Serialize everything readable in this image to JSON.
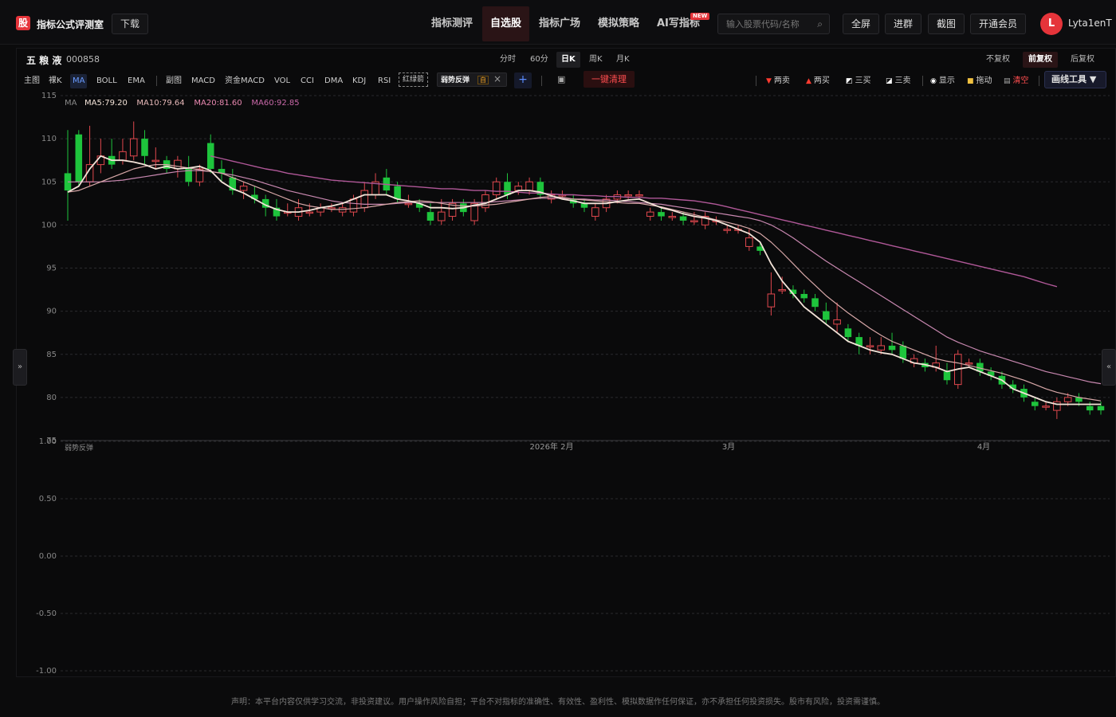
{
  "app": {
    "logo_char": "股",
    "brand": "指标公式评测室",
    "download": "下载"
  },
  "nav": {
    "tabs": [
      "指标测评",
      "自选股",
      "指标广场",
      "模拟策略",
      "AI写指标"
    ],
    "active_index": 1,
    "new_badge": "NEW"
  },
  "search": {
    "placeholder": "输入股票代码/名称"
  },
  "top_buttons": [
    "全屏",
    "进群",
    "截图",
    "开通会员"
  ],
  "user": {
    "avatar_letter": "L",
    "name": "Lyta1enT"
  },
  "stock": {
    "name": "五 粮 液",
    "code": "000858"
  },
  "periods": {
    "items": [
      "分时",
      "60分",
      "日K",
      "周K",
      "月K"
    ],
    "active_index": 2
  },
  "adjust": {
    "items": [
      "不复权",
      "前复权",
      "后复权"
    ],
    "active_index": 1
  },
  "indicators": {
    "main": [
      "主图",
      "裸K",
      "MA",
      "BOLL",
      "EMA"
    ],
    "main_active": "MA",
    "sub": [
      "副图",
      "MACD",
      "资金MACD",
      "VOL",
      "CCI",
      "DMA",
      "KDJ",
      "RSI"
    ],
    "hongluj": "红绿箭",
    "chip_label": "弱势反弹",
    "chip_tag": "自",
    "clear_all": "一键清理"
  },
  "toolbar": {
    "items": [
      {
        "label": "两卖",
        "icon": "down-triangle-icon",
        "color": "#ff3b30"
      },
      {
        "label": "两买",
        "icon": "up-triangle-icon",
        "color": "#ff3b30"
      },
      {
        "label": "三买",
        "icon": "chart-icon",
        "color": "#ffffff"
      },
      {
        "label": "三卖",
        "icon": "chart-icon",
        "color": "#ffffff"
      },
      {
        "label": "显示",
        "icon": "eye-icon",
        "color": "#ffffff"
      },
      {
        "label": "拖动",
        "icon": "lock-icon",
        "color": "#f0c040"
      },
      {
        "label": "清空",
        "icon": "trash-icon",
        "color": "#ff4d4f"
      }
    ],
    "draw_tools": "画线工具 ▼"
  },
  "legend": {
    "prefix": "MA",
    "items": [
      {
        "label": "MA5:79.20",
        "color": "#f3e3d8"
      },
      {
        "label": "MA10:79.64",
        "color": "#e6b8b8"
      },
      {
        "label": "MA20:81.60",
        "color": "#e888b0"
      },
      {
        "label": "MA60:92.85",
        "color": "#c868a8"
      }
    ]
  },
  "sub_label": "弱势反弹",
  "chart_data": {
    "type": "candlestick",
    "main_y_ticks": [
      115,
      110,
      105,
      100,
      95,
      90,
      85,
      80,
      75
    ],
    "sub_y_ticks": [
      "1.00",
      "0.50",
      "0.00",
      "-0.50",
      "-1.00"
    ],
    "x_labels": [
      "2026年  2月",
      "3月",
      "4月"
    ],
    "ylim": [
      75,
      115
    ],
    "candles": [
      [
        106.0,
        104.0,
        111.0,
        100.5
      ],
      [
        110.5,
        105.0,
        111.0,
        104.5
      ],
      [
        105.0,
        107.0,
        111.5,
        104.5
      ],
      [
        107.0,
        108.0,
        110.0,
        106.0
      ],
      [
        108.0,
        107.0,
        110.0,
        106.5
      ],
      [
        107.5,
        108.5,
        110.0,
        107.0
      ],
      [
        108.0,
        110.0,
        112.0,
        107.5
      ],
      [
        110.0,
        108.0,
        111.0,
        107.0
      ],
      [
        107.5,
        107.5,
        109.0,
        106.5
      ],
      [
        107.5,
        106.5,
        108.0,
        106.0
      ],
      [
        106.5,
        107.5,
        108.0,
        105.5
      ],
      [
        106.5,
        105.0,
        108.0,
        104.5
      ],
      [
        105.0,
        106.5,
        107.0,
        104.5
      ],
      [
        109.5,
        106.5,
        110.5,
        106.0
      ],
      [
        106.5,
        106.0,
        107.5,
        105.0
      ],
      [
        105.5,
        104.0,
        106.5,
        103.5
      ],
      [
        104.0,
        104.5,
        105.0,
        103.0
      ],
      [
        103.5,
        103.0,
        104.5,
        102.5
      ],
      [
        103.0,
        102.0,
        103.5,
        101.0
      ],
      [
        102.0,
        101.0,
        103.0,
        100.5
      ],
      [
        101.5,
        101.5,
        102.5,
        101.0
      ],
      [
        101.0,
        102.0,
        103.0,
        100.5
      ],
      [
        101.5,
        101.5,
        102.5,
        101.0
      ],
      [
        101.5,
        102.0,
        102.5,
        101.0
      ],
      [
        102.0,
        102.0,
        102.5,
        101.5
      ],
      [
        101.5,
        102.0,
        102.5,
        101.0
      ],
      [
        101.5,
        103.0,
        103.5,
        101.0
      ],
      [
        102.0,
        104.0,
        105.0,
        101.5
      ],
      [
        103.5,
        105.0,
        106.0,
        103.0
      ],
      [
        105.5,
        104.0,
        106.5,
        103.5
      ],
      [
        104.5,
        103.0,
        105.0,
        102.5
      ],
      [
        102.5,
        102.5,
        103.5,
        102.0
      ],
      [
        102.5,
        102.0,
        103.0,
        101.5
      ],
      [
        101.5,
        100.5,
        102.5,
        100.0
      ],
      [
        100.5,
        101.5,
        103.0,
        100.0
      ],
      [
        101.0,
        102.5,
        103.0,
        100.5
      ],
      [
        102.5,
        101.5,
        103.0,
        101.0
      ],
      [
        100.5,
        102.5,
        103.0,
        100.0
      ],
      [
        102.0,
        103.5,
        104.0,
        101.5
      ],
      [
        103.5,
        105.0,
        105.5,
        103.0
      ],
      [
        105.0,
        103.5,
        106.0,
        103.0
      ],
      [
        104.0,
        104.5,
        105.0,
        103.5
      ],
      [
        104.0,
        105.0,
        105.5,
        103.5
      ],
      [
        105.0,
        103.5,
        105.5,
        103.0
      ],
      [
        103.0,
        103.5,
        104.0,
        102.5
      ],
      [
        103.5,
        103.5,
        104.0,
        103.0
      ],
      [
        103.0,
        102.5,
        103.5,
        102.0
      ],
      [
        102.5,
        102.0,
        103.0,
        101.5
      ],
      [
        101.0,
        102.0,
        102.5,
        100.5
      ],
      [
        102.0,
        103.0,
        103.5,
        101.5
      ],
      [
        103.0,
        103.5,
        104.0,
        102.5
      ],
      [
        103.5,
        103.5,
        104.0,
        103.0
      ],
      [
        103.5,
        103.5,
        104.0,
        103.0
      ],
      [
        101.0,
        101.5,
        102.0,
        100.5
      ],
      [
        101.5,
        101.0,
        102.0,
        100.5
      ],
      [
        101.0,
        101.0,
        101.5,
        100.5
      ],
      [
        101.0,
        100.5,
        101.5,
        100.0
      ],
      [
        100.5,
        100.5,
        101.5,
        100.0
      ],
      [
        100.0,
        101.0,
        101.5,
        99.5
      ],
      [
        100.5,
        100.5,
        101.0,
        100.0
      ],
      [
        99.5,
        99.5,
        100.0,
        99.0
      ],
      [
        99.5,
        99.5,
        100.0,
        99.0
      ],
      [
        97.5,
        98.5,
        99.5,
        97.0
      ],
      [
        97.5,
        97.0,
        98.0,
        96.5
      ],
      [
        90.5,
        92.0,
        94.5,
        89.5
      ],
      [
        92.5,
        92.5,
        94.0,
        92.0
      ],
      [
        92.5,
        92.0,
        93.0,
        91.5
      ],
      [
        92.0,
        91.5,
        92.5,
        91.0
      ],
      [
        91.5,
        90.5,
        92.0,
        90.0
      ],
      [
        90.0,
        89.0,
        91.0,
        88.5
      ],
      [
        88.5,
        89.0,
        91.0,
        87.5
      ],
      [
        88.0,
        87.0,
        88.5,
        86.5
      ],
      [
        87.0,
        86.0,
        87.5,
        85.0
      ],
      [
        86.0,
        86.0,
        87.0,
        85.0
      ],
      [
        85.5,
        86.0,
        87.0,
        85.0
      ],
      [
        86.0,
        85.5,
        87.5,
        85.0
      ],
      [
        86.0,
        84.5,
        86.5,
        84.0
      ],
      [
        84.0,
        84.5,
        85.0,
        83.5
      ],
      [
        84.0,
        83.5,
        84.5,
        83.0
      ],
      [
        83.5,
        84.0,
        86.0,
        83.0
      ],
      [
        83.0,
        82.0,
        84.0,
        81.5
      ],
      [
        81.5,
        85.0,
        85.5,
        81.0
      ],
      [
        84.0,
        84.0,
        84.5,
        83.5
      ],
      [
        84.0,
        83.0,
        84.5,
        82.5
      ],
      [
        83.0,
        82.5,
        83.5,
        82.0
      ],
      [
        82.5,
        81.5,
        83.0,
        81.0
      ],
      [
        81.5,
        81.0,
        82.0,
        80.5
      ],
      [
        81.0,
        80.0,
        81.5,
        79.5
      ],
      [
        79.5,
        79.0,
        80.0,
        78.5
      ],
      [
        79.0,
        79.0,
        79.5,
        78.5
      ],
      [
        78.5,
        79.5,
        80.0,
        77.5
      ],
      [
        79.5,
        80.0,
        80.5,
        79.0
      ],
      [
        80.0,
        79.5,
        80.5,
        79.0
      ],
      [
        79.0,
        78.5,
        79.5,
        78.0
      ],
      [
        79.0,
        78.5,
        79.5,
        78.0
      ]
    ],
    "ma": {
      "MA5": [
        103.8,
        104.5,
        106.5,
        108.0,
        107.5,
        107.5,
        107.3,
        107.0,
        106.5,
        106.8,
        106.5,
        106.6,
        106.8,
        106.3,
        105.0,
        104.2,
        103.7,
        103.0,
        102.3,
        101.8,
        101.5,
        101.5,
        101.7,
        102.0,
        102.2,
        102.5,
        103.0,
        103.5,
        103.5,
        103.5,
        103.0,
        102.8,
        102.5,
        102.0,
        102.0,
        101.9,
        102.0,
        102.3,
        102.5,
        103.0,
        103.5,
        104.0,
        104.0,
        103.8,
        103.4,
        103.0,
        102.8,
        102.5,
        102.5,
        102.5,
        102.7,
        102.9,
        103.0,
        102.5,
        102.0,
        101.7,
        101.3,
        101.0,
        100.8,
        100.5,
        100.0,
        99.5,
        99.0,
        98.0,
        95.5,
        93.5,
        92.0,
        90.5,
        89.5,
        88.5,
        87.5,
        86.5,
        86.0,
        85.5,
        85.2,
        85.0,
        84.5,
        84.0,
        83.8,
        83.5,
        83.0,
        83.3,
        83.5,
        83.0,
        82.5,
        82.0,
        81.0,
        80.5,
        80.0,
        79.5,
        79.2,
        79.2,
        79.2,
        79.2,
        79.2
      ],
      "MA10": [
        103.8,
        104.0,
        104.5,
        105.0,
        105.5,
        106.0,
        106.5,
        106.8,
        107.0,
        107.0,
        106.8,
        106.6,
        106.4,
        106.2,
        106.0,
        105.5,
        105.0,
        104.5,
        104.0,
        103.5,
        103.0,
        102.5,
        102.2,
        102.0,
        101.8,
        101.8,
        101.9,
        102.0,
        102.2,
        102.4,
        102.6,
        102.7,
        102.8,
        102.7,
        102.5,
        102.3,
        102.2,
        102.2,
        102.3,
        102.4,
        102.6,
        102.8,
        103.0,
        103.2,
        103.3,
        103.2,
        103.0,
        102.9,
        102.8,
        102.7,
        102.6,
        102.5,
        102.5,
        102.3,
        102.1,
        101.8,
        101.5,
        101.2,
        100.9,
        100.6,
        100.3,
        100.0,
        99.6,
        99.0,
        98.0,
        96.8,
        95.5,
        94.2,
        93.0,
        91.8,
        90.8,
        89.8,
        88.9,
        88.0,
        87.2,
        86.5,
        86.0,
        85.5,
        85.0,
        84.5,
        84.2,
        84.0,
        83.7,
        83.4,
        83.1,
        82.8,
        82.4,
        82.0,
        81.5,
        81.0,
        80.6,
        80.3,
        80.0,
        79.8,
        79.6
      ],
      "MA20": [
        105.0,
        105.0,
        105.0,
        105.0,
        105.1,
        105.2,
        105.4,
        105.6,
        105.8,
        106.0,
        106.2,
        106.3,
        106.3,
        106.2,
        106.0,
        105.8,
        105.5,
        105.2,
        104.8,
        104.4,
        104.0,
        103.7,
        103.4,
        103.1,
        102.8,
        102.6,
        102.5,
        102.4,
        102.4,
        102.4,
        102.5,
        102.6,
        102.6,
        102.6,
        102.6,
        102.6,
        102.6,
        102.6,
        102.6,
        102.7,
        102.8,
        102.9,
        103.0,
        103.1,
        103.1,
        103.1,
        103.0,
        103.0,
        102.9,
        102.9,
        102.8,
        102.7,
        102.6,
        102.5,
        102.4,
        102.2,
        102.0,
        101.8,
        101.6,
        101.4,
        101.2,
        101.0,
        100.8,
        100.5,
        100.0,
        99.3,
        98.5,
        97.6,
        96.7,
        95.8,
        95.0,
        94.2,
        93.4,
        92.6,
        91.8,
        91.0,
        90.2,
        89.4,
        88.6,
        87.8,
        87.0,
        86.4,
        85.9,
        85.4,
        85.0,
        84.6,
        84.2,
        83.8,
        83.4,
        83.0,
        82.7,
        82.4,
        82.1,
        81.8,
        81.6
      ],
      "MA60_start": 13,
      "MA60": [
        108.0,
        107.7,
        107.4,
        107.1,
        106.8,
        106.5,
        106.3,
        106.0,
        105.8,
        105.6,
        105.4,
        105.2,
        105.1,
        105.0,
        104.9,
        104.8,
        104.7,
        104.6,
        104.5,
        104.4,
        104.3,
        104.2,
        104.2,
        104.1,
        104.0,
        104.0,
        103.9,
        103.9,
        103.8,
        103.7,
        103.7,
        103.6,
        103.5,
        103.5,
        103.4,
        103.4,
        103.3,
        103.3,
        103.2,
        103.2,
        103.1,
        103.1,
        103.0,
        102.9,
        102.8,
        102.6,
        102.4,
        102.1,
        101.8,
        101.5,
        101.2,
        100.9,
        100.6,
        100.3,
        100.0,
        99.7,
        99.4,
        99.1,
        98.8,
        98.5,
        98.2,
        97.9,
        97.6,
        97.3,
        97.0,
        96.7,
        96.4,
        96.1,
        95.8,
        95.5,
        95.2,
        94.9,
        94.6,
        94.3,
        94.0,
        93.6,
        93.2,
        92.85
      ]
    }
  },
  "disclaimer": "声明：本平台内容仅供学习交流，非投资建议。用户操作风险自担；平台不对指标的准确性、有效性、盈利性、模拟数据作任何保证，亦不承担任何投资损失。股市有风险，投资需谨慎。",
  "side": {
    "left_arrow": "»",
    "right_arrow": "«"
  }
}
